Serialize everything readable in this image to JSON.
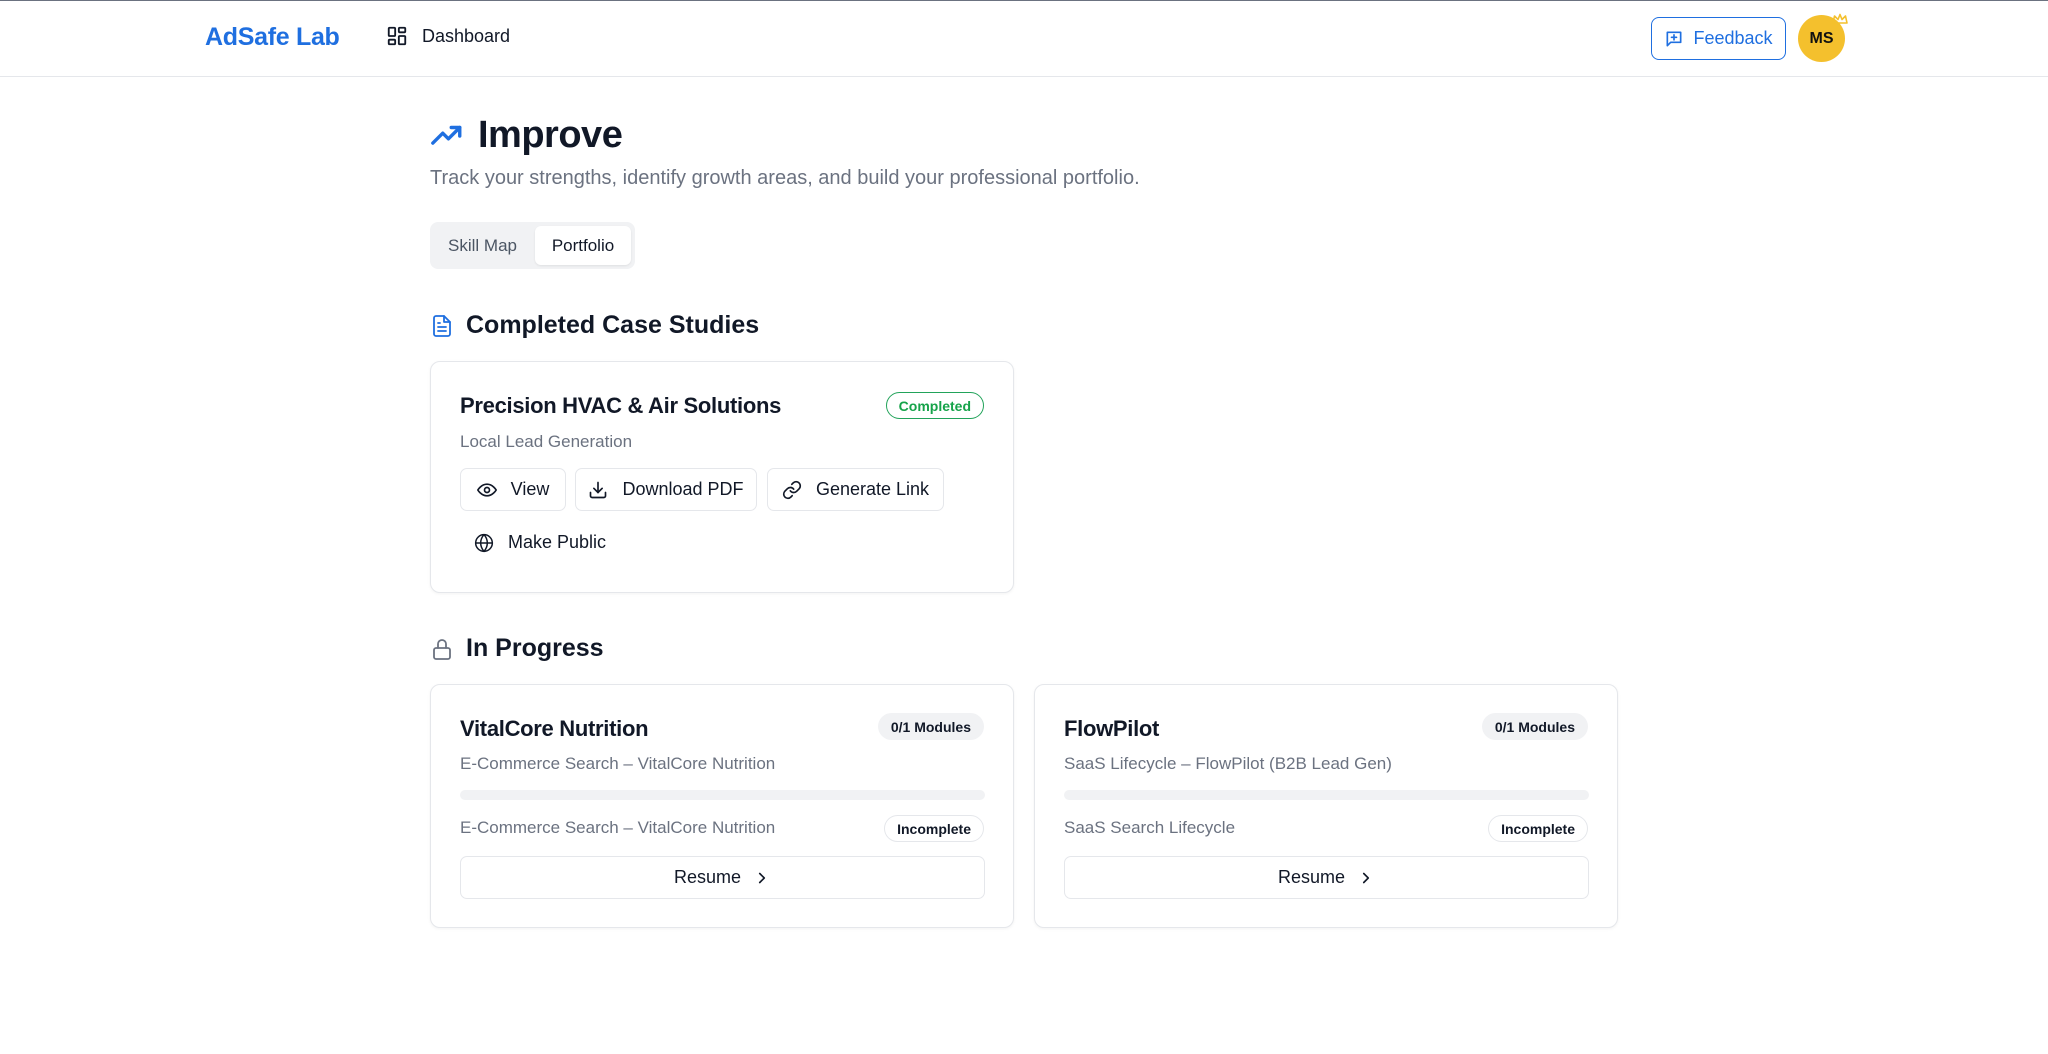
{
  "header": {
    "brand": "AdSafe Lab",
    "nav_dashboard": "Dashboard",
    "feedback_label": "Feedback",
    "avatar_initials": "MS"
  },
  "page": {
    "title": "Improve",
    "subtitle": "Track your strengths, identify growth areas, and build your professional portfolio."
  },
  "tabs": [
    {
      "label": "Skill Map",
      "active": false
    },
    {
      "label": "Portfolio",
      "active": true
    }
  ],
  "completed": {
    "heading": "Completed Case Studies",
    "cards": [
      {
        "title": "Precision HVAC & Air Solutions",
        "subtitle": "Local Lead Generation",
        "status": "Completed",
        "actions": {
          "view": "View",
          "download": "Download PDF",
          "link": "Generate Link",
          "public": "Make Public"
        }
      }
    ]
  },
  "in_progress": {
    "heading": "In Progress",
    "cards": [
      {
        "title": "VitalCore Nutrition",
        "modules": "0/1 Modules",
        "subtitle": "E-Commerce Search – VitalCore Nutrition",
        "progress": 0,
        "module_name": "E-Commerce Search – VitalCore Nutrition",
        "module_status": "Incomplete",
        "resume_label": "Resume"
      },
      {
        "title": "FlowPilot",
        "modules": "0/1 Modules",
        "subtitle": "SaaS Lifecycle – FlowPilot (B2B Lead Gen)",
        "progress": 0,
        "module_name": "SaaS Search Lifecycle",
        "module_status": "Incomplete",
        "resume_label": "Resume"
      }
    ]
  },
  "icons": {
    "dashboard": "grid-icon",
    "feedback": "message-plus-icon",
    "title": "trending-up-icon",
    "completed": "file-text-icon",
    "in_progress": "lock-icon",
    "view": "eye-icon",
    "download": "download-icon",
    "link": "link-icon",
    "public": "globe-icon",
    "resume": "chevron-right-icon",
    "avatar_badge": "crown-icon"
  },
  "colors": {
    "brand": "#1f6fe0",
    "success": "#16a34a",
    "avatar": "#f4c02d"
  }
}
